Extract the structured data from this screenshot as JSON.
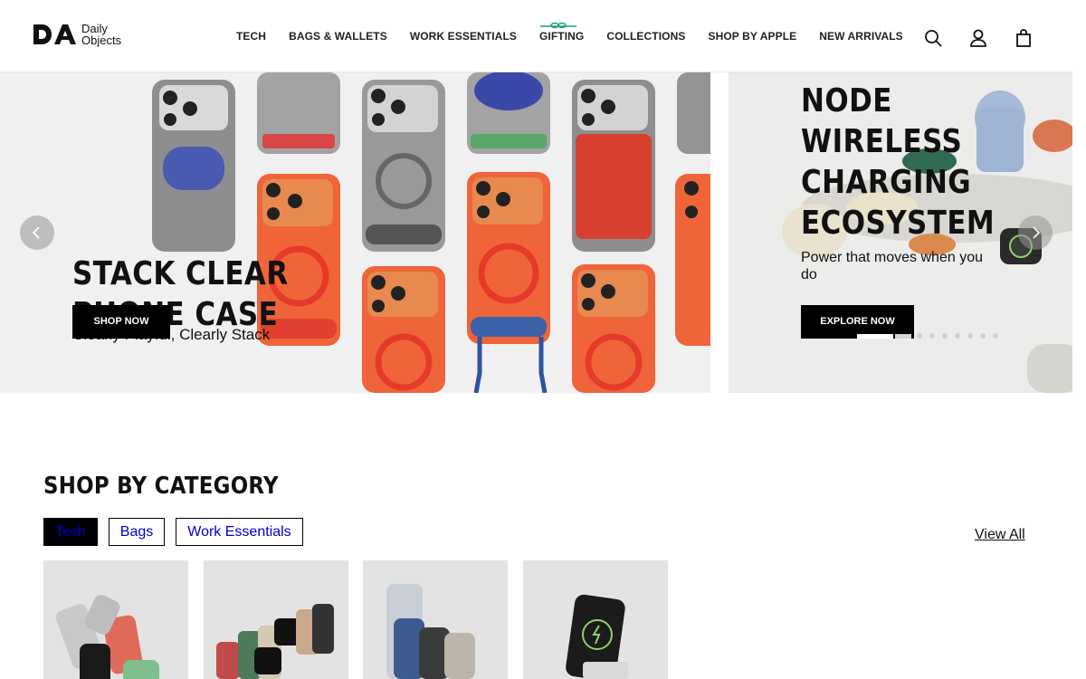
{
  "header": {
    "logo": {
      "line1": "Daily",
      "line2": "Objects"
    },
    "nav": [
      {
        "label": "TECH",
        "name": "nav-tech"
      },
      {
        "label": "BAGS & WALLETS",
        "name": "nav-bags-wallets"
      },
      {
        "label": "WORK ESSENTIALS",
        "name": "nav-work-essentials"
      },
      {
        "label": "GIFTING",
        "name": "nav-gifting"
      },
      {
        "label": "COLLECTIONS",
        "name": "nav-collections"
      },
      {
        "label": "SHOP BY APPLE",
        "name": "nav-shop-by-apple"
      },
      {
        "label": "NEW ARRIVALS",
        "name": "nav-new-arrivals"
      }
    ],
    "icons": [
      "search-icon",
      "account-icon",
      "cart-icon"
    ]
  },
  "hero": {
    "slides": [
      {
        "title_line1": "STACK CLEAR",
        "title_line2": "PHONE CASE",
        "subtitle": "Clearly Playful, Clearly Stack",
        "cta": "SHOP NOW"
      },
      {
        "title_line1": "NODE",
        "title_line2": "WIRELESS",
        "title_line3": "CHARGING",
        "title_line4": "ECOSYSTEM",
        "subtitle": "Power that moves when you do",
        "cta": "EXPLORE NOW"
      }
    ],
    "pagination": {
      "total": 9,
      "active": 1
    }
  },
  "category": {
    "title": "SHOP BY CATEGORY",
    "tabs": [
      "Tech",
      "Bags",
      "Work Essentials"
    ],
    "active_tab": "Tech",
    "view_all": "View All"
  },
  "colors": {
    "accent": "#000000",
    "tab_text": "#0000cc",
    "hero_bg": "#f0f0f0",
    "case_orange": "#f0643a",
    "case_grey": "#8a8a8a"
  }
}
